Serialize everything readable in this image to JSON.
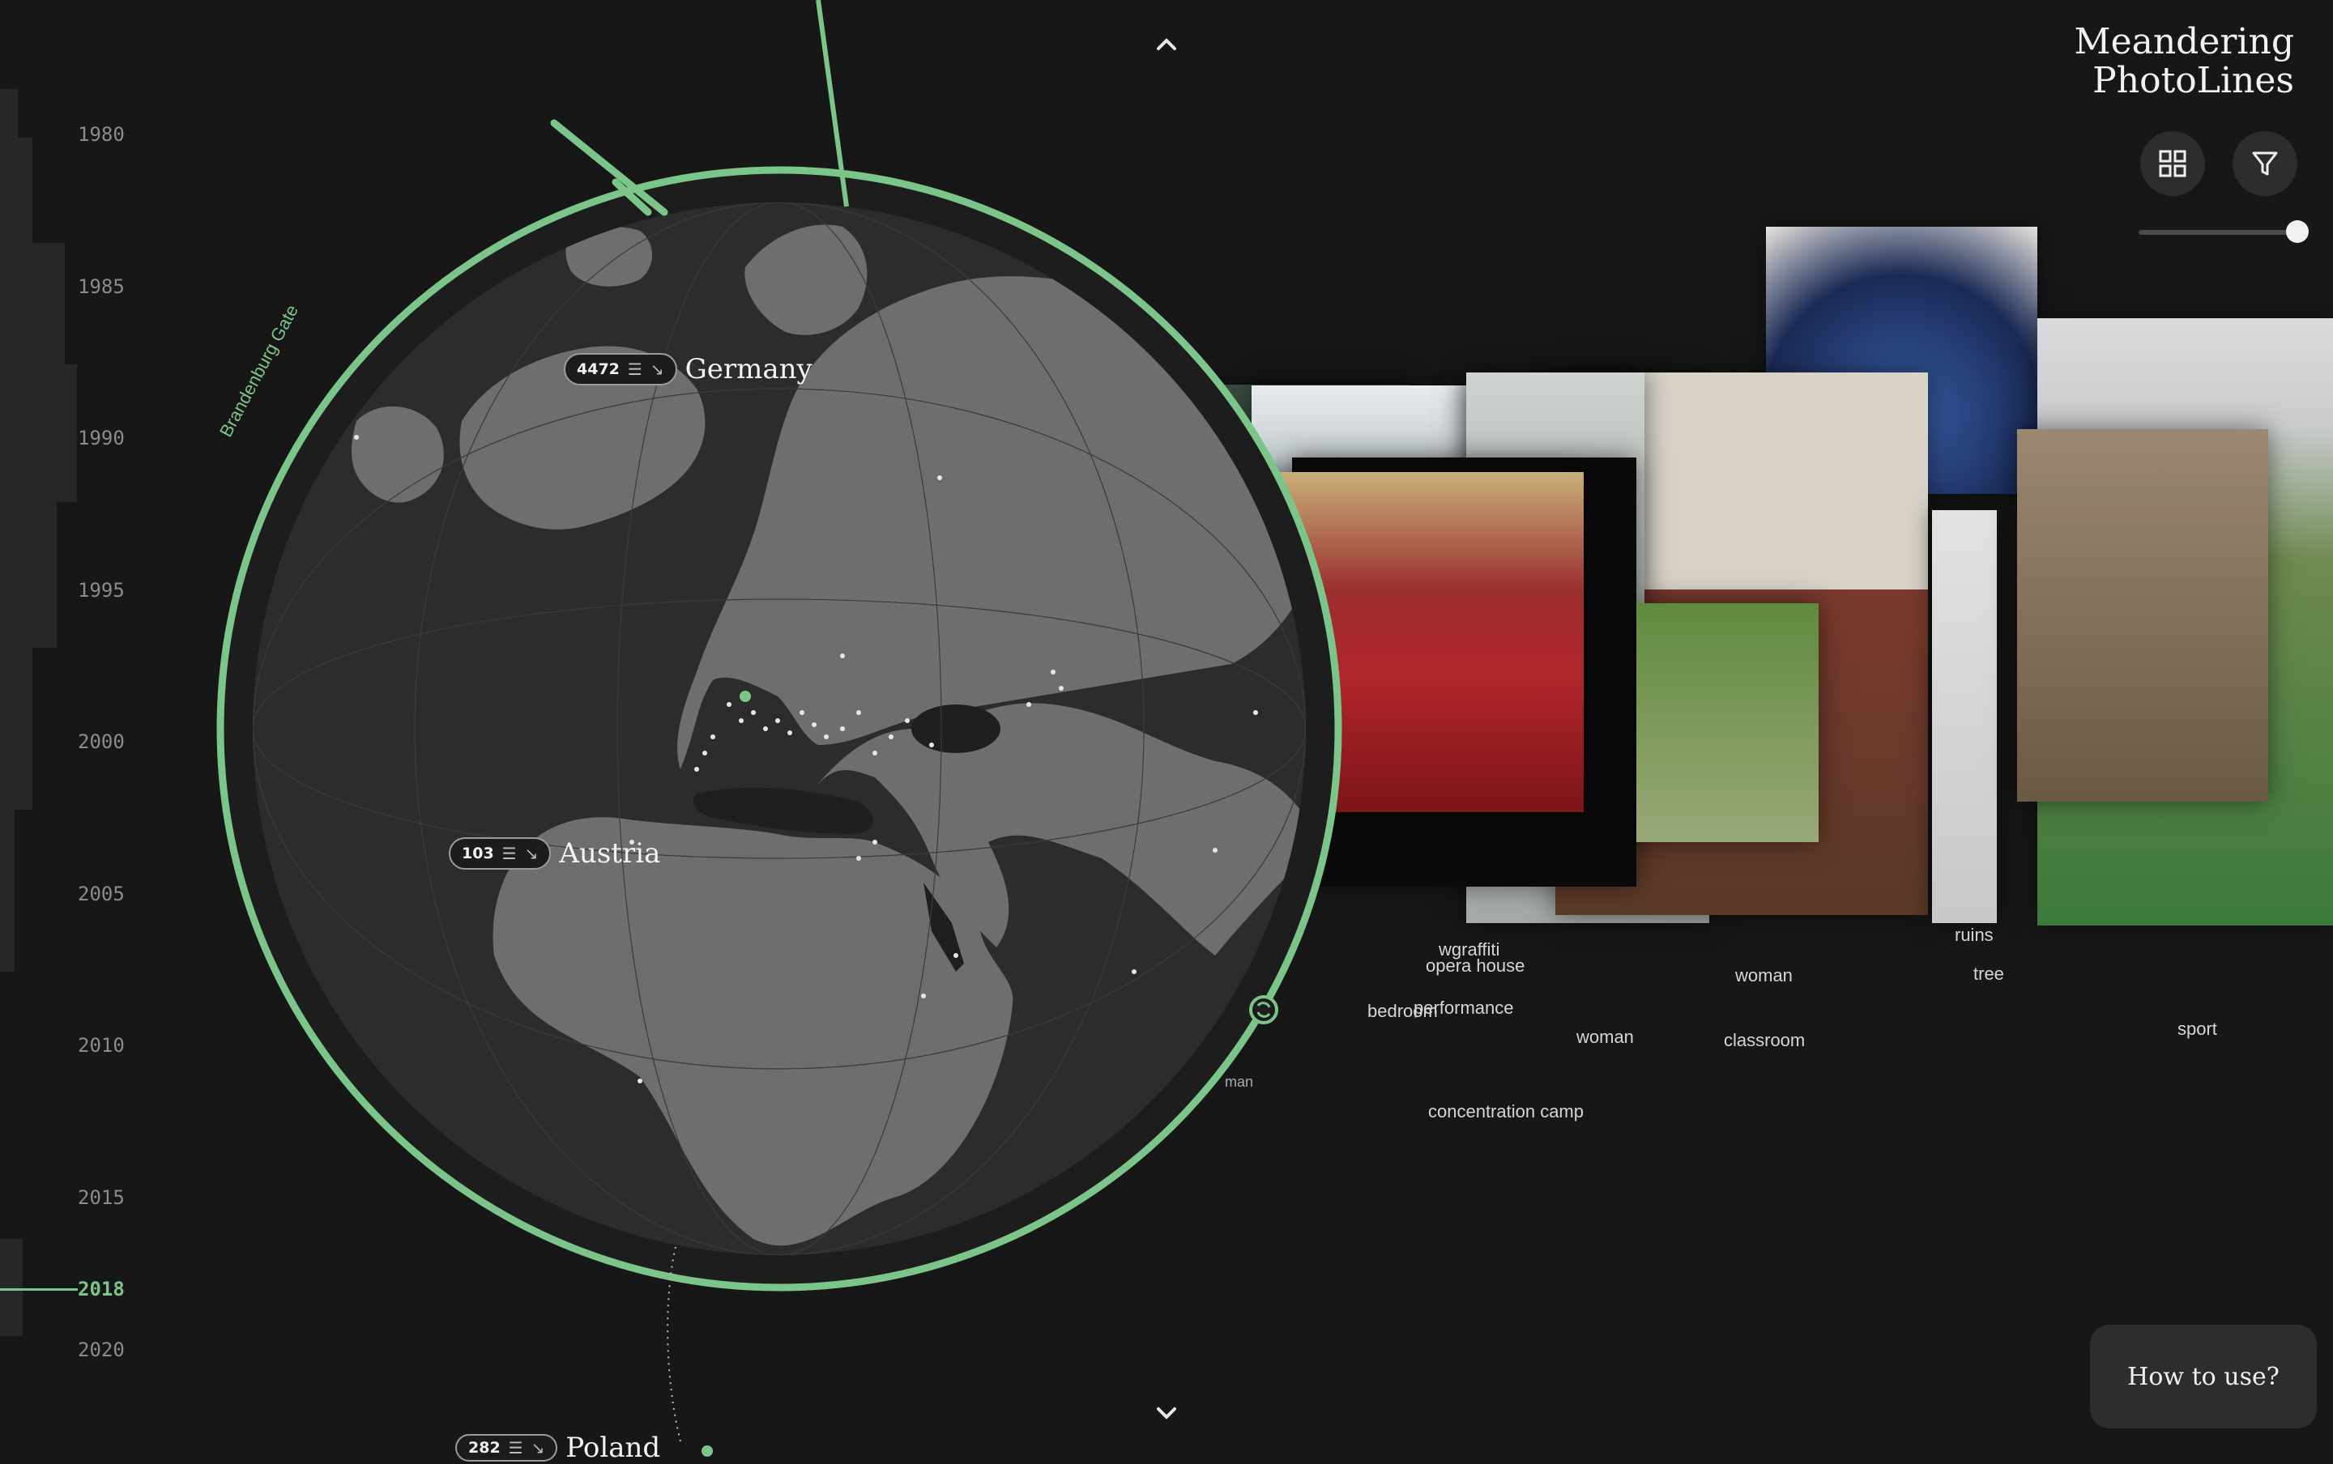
{
  "app": {
    "title_line1": "Meandering",
    "title_line2": "PhotoLines"
  },
  "timeline": {
    "years": [
      "1980",
      "1985",
      "1990",
      "1995",
      "2000",
      "2005",
      "2010",
      "2015",
      "2020"
    ],
    "current_year": "2018"
  },
  "globe": {
    "place_label": "Brandenburg Gate",
    "countries": [
      {
        "name": "Germany",
        "count": "4472"
      },
      {
        "name": "Austria",
        "count": "103"
      },
      {
        "name": "Poland",
        "count": "282"
      }
    ]
  },
  "tags": {
    "wgraffiti": "wgraffiti",
    "opera_house": "opera house",
    "bedroom": "bedroom",
    "performance": "performance",
    "woman1": "woman",
    "woman2": "woman",
    "classroom": "classroom",
    "ruins": "ruins",
    "tree": "tree",
    "sport": "sport",
    "concentration_camp": "concentration camp",
    "man": "man"
  },
  "controls": {
    "grid_icon": "grid-icon",
    "filter_icon": "filter-icon",
    "slider_value": 0.98,
    "how_to": "How to use?"
  },
  "colors": {
    "accent": "#7cc58a",
    "background": "#161716",
    "land": "#6e6e6e",
    "sea": "#2b2c2b"
  }
}
